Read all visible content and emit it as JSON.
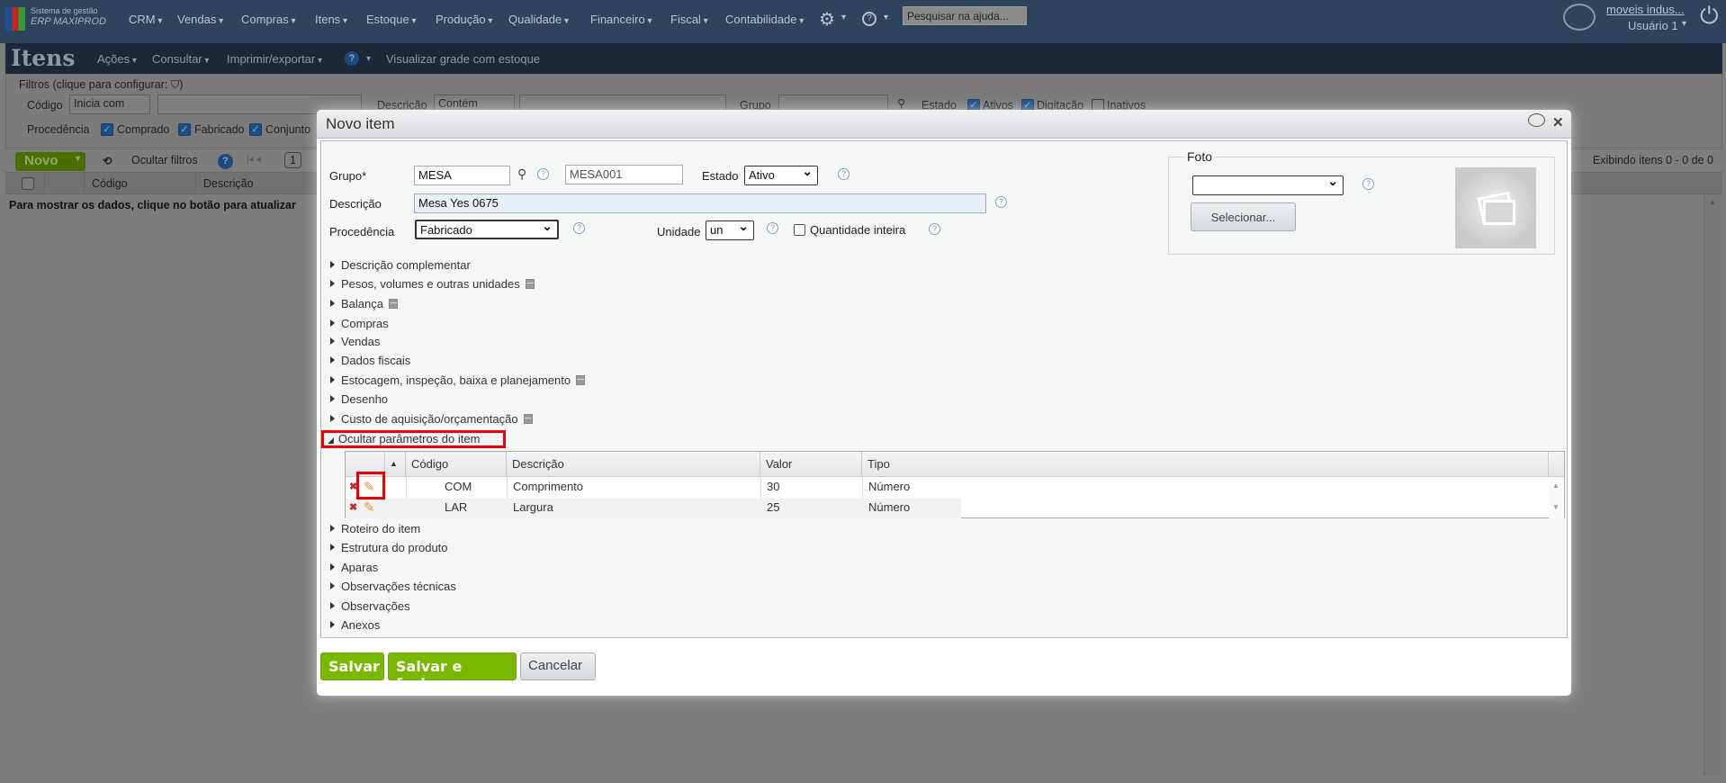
{
  "topbar": {
    "brand_line1": "Sistema de gestão",
    "brand_line2": "ERP MAXIPROD",
    "menu": [
      "CRM",
      "Vendas",
      "Compras",
      "Itens",
      "Estoque",
      "Produção",
      "Qualidade",
      "Financeiro",
      "Fiscal",
      "Contabilidade"
    ],
    "search_placeholder": "Pesquisar na ajuda...",
    "company": "moveis indus...",
    "user": "Usuário 1"
  },
  "page": {
    "title": "Itens",
    "menu": [
      "Ações",
      "Consultar",
      "Imprimir/exportar"
    ],
    "grid_stock": "Visualizar grade com estoque"
  },
  "filters": {
    "legend": "Filtros (clique para configurar:",
    "codigo": "Código",
    "codigo_op": "Inicia com",
    "descricao": "Descrição",
    "descricao_op": "Contém",
    "grupo": "Grupo",
    "estado": "Estado",
    "ativos": "Ativos",
    "digitacao": "Digitação",
    "inativos": "Inativos",
    "procedencia": "Procedência",
    "comprado": "Comprado",
    "fabricado": "Fabricado",
    "conjunto": "Conjunto"
  },
  "toolbar": {
    "novo": "Novo",
    "hide_filters": "Ocultar filtros",
    "page": "1",
    "showing": "Exibindo itens 0 - 0 de 0"
  },
  "grid": {
    "col_codigo": "Código",
    "col_descricao": "Descrição",
    "message": "Para mostrar os dados, clique no botão para atualizar"
  },
  "dialog": {
    "title": "Novo item",
    "grupo_label": "Grupo*",
    "grupo_value": "MESA",
    "codigo_value": "MESA001",
    "estado_label": "Estado",
    "estado_value": "Ativo",
    "descricao_label": "Descrição",
    "descricao_value": "Mesa Yes 0675",
    "procedencia_label": "Procedência",
    "procedencia_value": "Fabricado",
    "unidade_label": "Unidade",
    "unidade_value": "un",
    "qtd_inteira": "Quantidade inteira",
    "foto_legend": "Foto",
    "foto_value": "",
    "selecionar": "Selecionar...",
    "sections_top": [
      "Descrição complementar",
      "Pesos, volumes e outras unidades",
      "Balança",
      "Compras",
      "Vendas",
      "Dados fiscais",
      "Estocagem, inspeção, baixa e planejamento",
      "Desenho",
      "Custo de aquisição/orçamentação"
    ],
    "params_toggle": "Ocultar parâmetros do item",
    "params_headers": [
      "Código",
      "Descrição",
      "Valor",
      "Tipo"
    ],
    "params_rows": [
      [
        "COM",
        "Comprimento",
        "30",
        "Número"
      ],
      [
        "LAR",
        "Largura",
        "25",
        "Número"
      ]
    ],
    "sections_bottom": [
      "Roteiro do item",
      "Estrutura do produto",
      "Aparas",
      "Observações técnicas",
      "Observações",
      "Anexos"
    ],
    "save": "Salvar",
    "save_close": "Salvar e fechar",
    "cancel": "Cancelar"
  },
  "colors": {
    "topbar": "#2e435c",
    "green": "#7ab800",
    "highlight": "#ee0000"
  }
}
